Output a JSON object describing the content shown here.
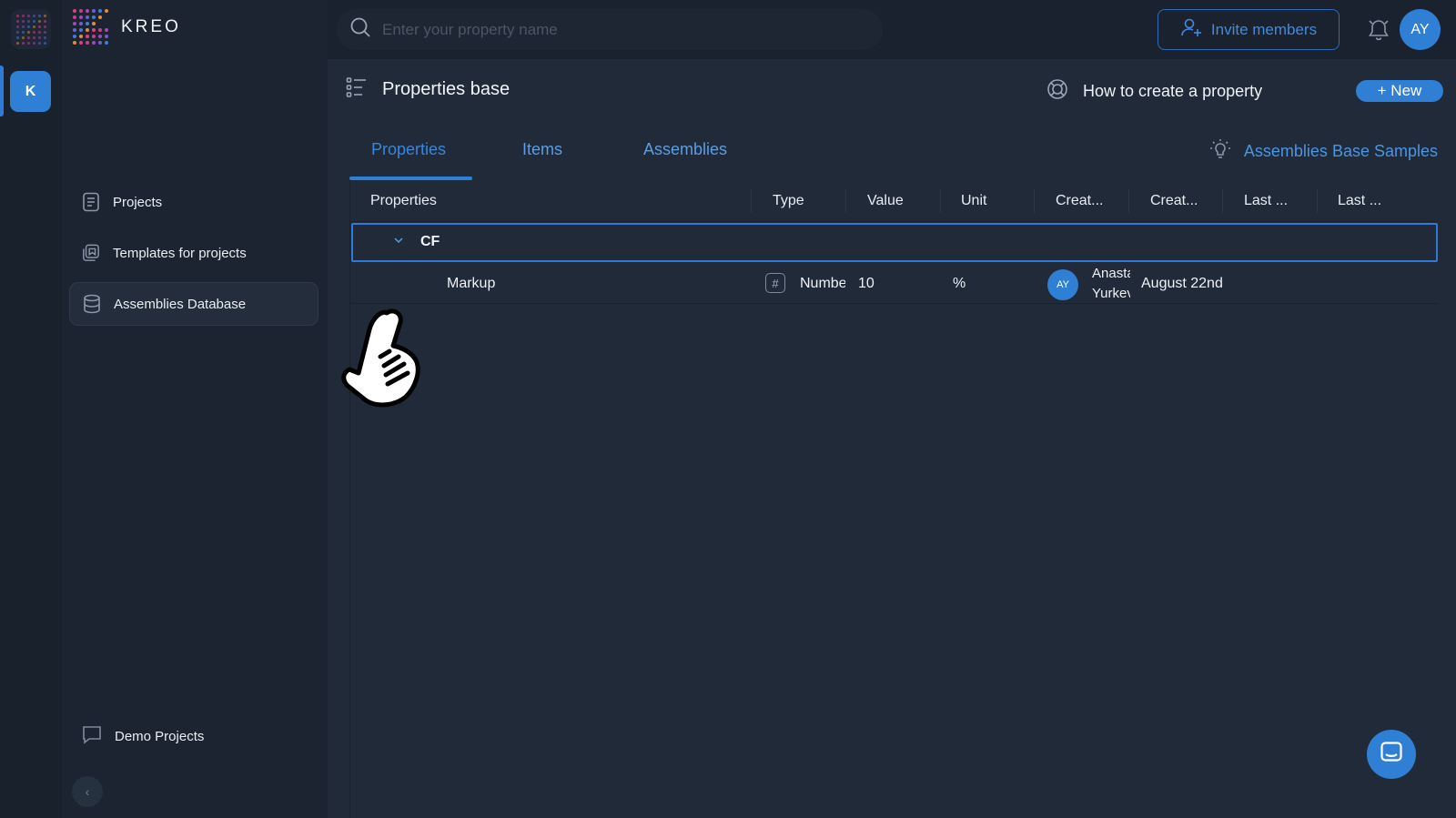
{
  "app": {
    "brand": "KREO",
    "workspace_initial": "K"
  },
  "search": {
    "placeholder": "Enter your property name"
  },
  "topbar": {
    "invite_label": "Invite members",
    "user_initials": "AY"
  },
  "sidebar": {
    "items": [
      {
        "label": "Projects",
        "icon": "document-icon"
      },
      {
        "label": "Templates for projects",
        "icon": "template-icon"
      },
      {
        "label": "Assemblies Database",
        "icon": "database-icon",
        "active": true
      }
    ],
    "demo_label": "Demo Projects"
  },
  "page": {
    "title": "Properties base",
    "help_link": "How to create a property",
    "new_button": "+ New",
    "samples_link": "Assemblies Base Samples"
  },
  "tabs": [
    {
      "label": "Properties",
      "active": true
    },
    {
      "label": "Items",
      "active": false
    },
    {
      "label": "Assemblies",
      "active": false
    }
  ],
  "table": {
    "columns": [
      "Properties",
      "Type",
      "Value",
      "Unit",
      "Creat...",
      "Creat...",
      "Last ...",
      "Last ..."
    ],
    "groups": [
      {
        "name": "CF",
        "rows": [
          {
            "name": "Markup",
            "type": "Numbe",
            "value": "10",
            "unit": "%",
            "creator_initials": "AY",
            "creator_line1": "Anasta",
            "creator_line2": "Yurkev",
            "created_date": "August 22nd"
          }
        ]
      }
    ]
  },
  "colors": {
    "accent": "#2f7fd4",
    "background": "#202a38",
    "sidebar": "#1c2431"
  }
}
